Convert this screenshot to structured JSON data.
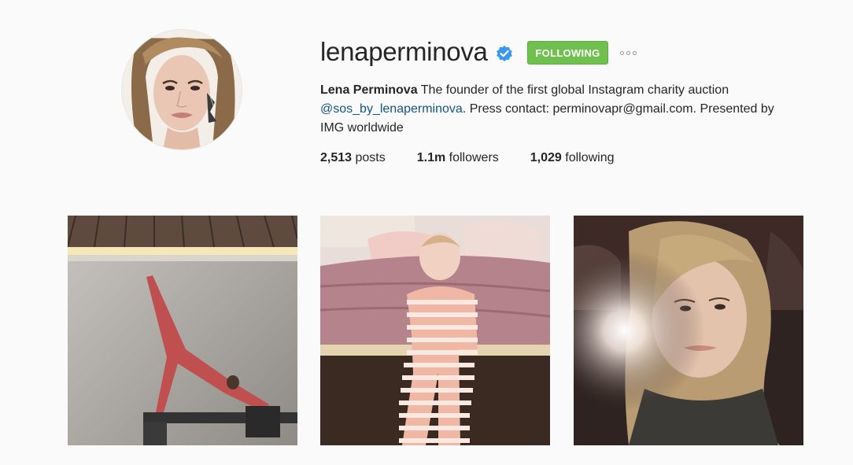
{
  "profile": {
    "username": "lenaperminova",
    "verified": true,
    "follow_label": "FOLLOWING",
    "full_name": "Lena Perminova",
    "bio_text_1": " The founder of the first global Instagram charity auction ",
    "bio_link": "@sos_by_lenaperminova",
    "bio_text_2": ". Press contact: perminovapr@gmail.com. Presented by IMG worldwide"
  },
  "stats": {
    "posts_count": "2,513",
    "posts_label": " posts",
    "followers_count": "1.1m",
    "followers_label": " followers",
    "following_count": "1,029",
    "following_label": " following"
  },
  "posts": [
    {
      "icon": "photo-woman-stretching"
    },
    {
      "icon": "photo-baby-striped-pajamas"
    },
    {
      "icon": "photo-woman-selfie"
    }
  ],
  "colors": {
    "follow_button": "#70c050",
    "link": "#125688",
    "verified_badge": "#3897f0"
  }
}
